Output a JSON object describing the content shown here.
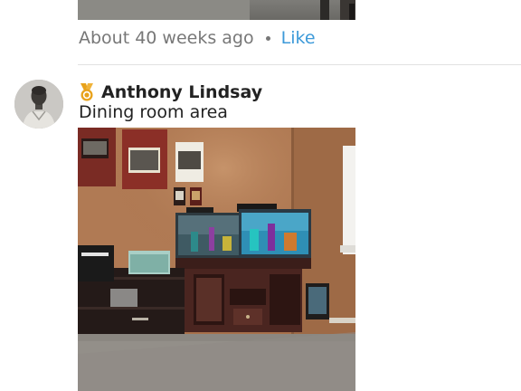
{
  "previous_post": {
    "timestamp": "About 40 weeks ago",
    "like_label": "Like"
  },
  "post": {
    "author": {
      "name": "Anthony Lindsay",
      "badge_icon": "medal-icon",
      "avatar_icon": "user-avatar"
    },
    "text": "Dining room area"
  },
  "colors": {
    "link": "#3d9ad9",
    "meta_text": "#777777",
    "primary_text": "#222222",
    "badge_gold": "#e8a21b"
  }
}
